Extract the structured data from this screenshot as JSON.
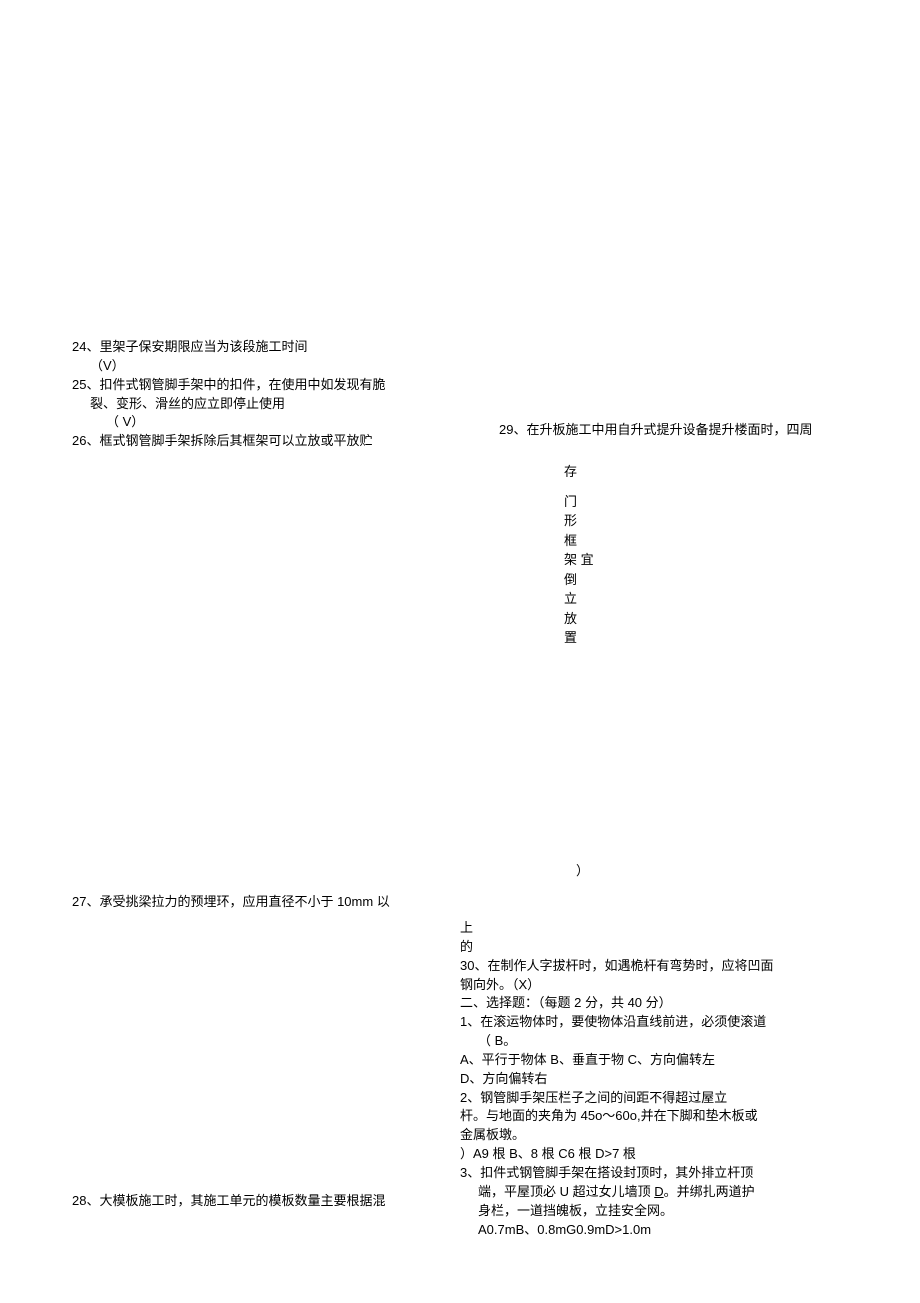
{
  "q24": {
    "text": "24、里架子保安期限应当为该段施工时间",
    "ans": "（V）"
  },
  "q25": {
    "text": "25、扣件式钢管脚手架中的扣件，在使用中如发现有脆",
    "cont": "裂、变形、滑丝的应立即停止使用",
    "ans": "（ V）"
  },
  "q26": {
    "text": "26、框式钢管脚手架拆除后其框架可以立放或平放贮"
  },
  "q27": {
    "text": "27、承受挑梁拉力的预埋环，应用直径不小于 10mm 以"
  },
  "q28": {
    "text": "28、大模板施工时，其施工单元的模板数量主要根据混"
  },
  "q29": {
    "text": "29、在升板施工中用自升式提升设备提升楼面时，四周"
  },
  "vertA": {
    "c1": "存",
    "c2": "门",
    "c3": "形",
    "c4": "框",
    "c5": "架 宜",
    "c6": "倒",
    "c7": "立",
    "c8": "放",
    "c9": "置"
  },
  "paren": "）",
  "col2b": {
    "l1": "上",
    "l2": "的",
    "q30": "30、在制作人字拔杆时，如遇桅杆有弯势时，应将凹面",
    "q30b": "钢向外。（X）",
    "sec2": "二、选择题：（每题 2 分，共 40 分）",
    "q1": "1、在滚运物体时，要使物体沿直线前进，必须使滚道",
    "q1b": "（ B。",
    "q1opt1": "A、平行于物体 B、垂直于物 C、方向偏转左",
    "q1opt2": "D、方向偏转右",
    "q2a": "2、钢管脚手架压栏子之间的间距不得超过屋立",
    "q2b": "杆。与地面的夹角为 45o～60o,并在下脚和垫木板或",
    "q2c": "金属板墩。",
    "q2d": "）A9 根 B、8 根 C6 根 D>7 根",
    "q3a": "3、扣件式钢管脚手架在搭设封顶时，其外排立杆顶",
    "q3b": "端，平屋顶必 U 超过女儿墙顶 ",
    "q3b_u": "D",
    "q3b_after": "。并绑扎两道护",
    "q3c": "身栏，一道挡魄板，立挂安全网。",
    "q3d": "A0.7mB、0.8mG0.9mD>1.0m"
  }
}
